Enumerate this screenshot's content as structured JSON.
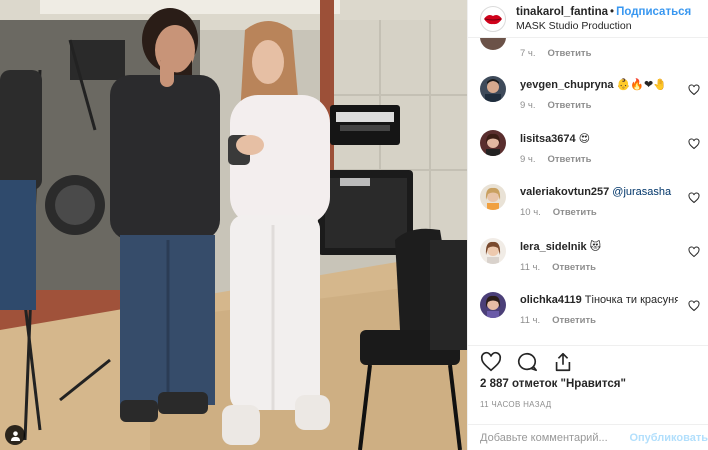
{
  "post": {
    "username": "tinakarol_fantina",
    "separator": "•",
    "follow_label": "Подписаться",
    "location": "MASK Studio Production"
  },
  "first_comment_meta": {
    "time": "7 ч.",
    "reply_label": "Ответить"
  },
  "comments": [
    {
      "username": "yevgen_chupryna",
      "text": "👶🔥❤🤚",
      "time": "9 ч.",
      "reply_label": "Ответить"
    },
    {
      "username": "lisitsa3674",
      "text": "😍",
      "time": "9 ч.",
      "reply_label": "Ответить"
    },
    {
      "username": "valeriakovtun257",
      "text": "@jurasasha",
      "time": "10 ч.",
      "reply_label": "Ответить"
    },
    {
      "username": "lera_sidelnik",
      "text": "😻",
      "time": "11 ч.",
      "reply_label": "Ответить"
    },
    {
      "username": "olichka4119",
      "text": "Тіночка ти красуня",
      "time": "11 ч.",
      "reply_label": "Ответить"
    }
  ],
  "likes_text": "2 887 отметок \"Нравится\"",
  "time_ago": "11 ЧАСОВ НАЗАД",
  "add_comment": {
    "placeholder": "Добавьте комментарий...",
    "publish_label": "Опубликовать"
  },
  "icons": {
    "header_avatar": "red-lips-logo-icon",
    "like": "heart-outline-icon",
    "comment": "speech-bubble-icon",
    "share": "share-arrow-icon",
    "comment_like": "small-heart-icon",
    "tag": "user-tag-icon"
  },
  "colors": {
    "follow": "#3897f0",
    "publish_disabled": "#b2dffc",
    "secondary_text": "#8e8e8e",
    "lips": "#d0021b"
  }
}
